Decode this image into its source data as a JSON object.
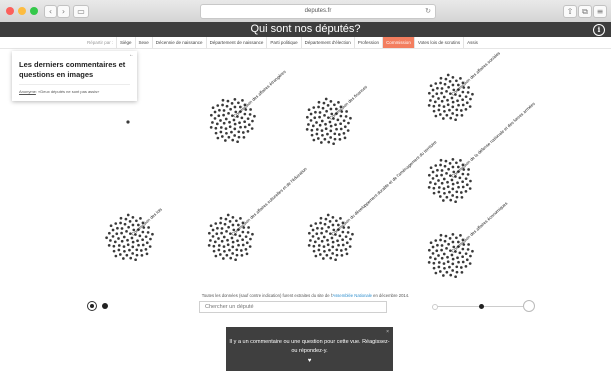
{
  "browser": {
    "url": "deputes.fr",
    "back_glyph": "‹",
    "forward_glyph": "›",
    "sidebar_glyph": "▭",
    "reload_glyph": "↻",
    "traffic_lights": [
      "#fc605c",
      "#fdbc40",
      "#34c84a"
    ],
    "share_glyph": "⇧",
    "tabs_glyph": "⧉",
    "menu_glyph": "≡"
  },
  "header": {
    "title": "Qui sont nos députés?",
    "info_glyph": "i",
    "background": "#3d3d3d"
  },
  "filters": {
    "label": "Répartir par :",
    "tabs": [
      {
        "label": "Siège",
        "active": false
      },
      {
        "label": "Sexe",
        "active": false
      },
      {
        "label": "Décennie de naissance",
        "active": false
      },
      {
        "label": "Département de naissance",
        "active": false
      },
      {
        "label": "Parti politique",
        "active": false
      },
      {
        "label": "Département d'élection",
        "active": false
      },
      {
        "label": "Profession",
        "active": false
      },
      {
        "label": "Commission",
        "active": true
      },
      {
        "label": "Votes lois de scrutins",
        "active": false
      },
      {
        "label": "Assis",
        "active": false
      }
    ],
    "active_color": "#f37e5f"
  },
  "comments_panel": {
    "close_glyph": "←",
    "title": "Les derniers commentaires et questions en images",
    "author": "Anonyme",
    "comment": " «Deux députés ne sont pas assis»"
  },
  "plot": {
    "dot_color": "#3a3a3a",
    "clusters": [
      {
        "label": "Commission des affaires étrangères",
        "count": 70
      },
      {
        "label": "Commission des finances",
        "count": 72
      },
      {
        "label": "Commission des affaires sociales",
        "count": 71
      },
      {
        "label": "Commission de la défense nationale et des forces armées",
        "count": 68
      },
      {
        "label": "Commission des lois",
        "count": 73
      },
      {
        "label": "Commission des affaires culturelles et de l'éducation",
        "count": 72
      },
      {
        "label": "Commission du développement durable et de l'aménagement du territoire",
        "count": 72
      },
      {
        "label": "Commission des affaires économiques",
        "count": 70
      }
    ],
    "unassigned": {
      "label": "",
      "count": 1
    }
  },
  "footer": {
    "credit_before": "Toutes les données (sauf contre indication) furent extraites du site de l'",
    "credit_link": "Assemblée Nationale",
    "credit_after": " en décembre 2014.",
    "search_placeholder": "Chercher un député"
  },
  "notification": {
    "text": "Il y a un commentaire ou une question pour cette vue. Réagissez- ou répondez-y.",
    "heart_glyph": "♥",
    "close_glyph": "×"
  }
}
